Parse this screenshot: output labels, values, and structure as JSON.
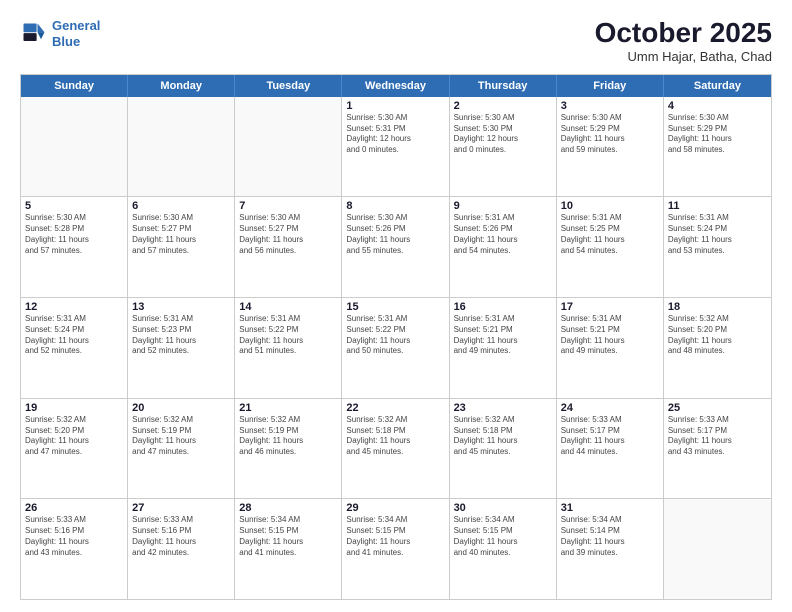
{
  "header": {
    "logo_line1": "General",
    "logo_line2": "Blue",
    "month": "October 2025",
    "location": "Umm Hajar, Batha, Chad"
  },
  "weekdays": [
    "Sunday",
    "Monday",
    "Tuesday",
    "Wednesday",
    "Thursday",
    "Friday",
    "Saturday"
  ],
  "rows": [
    [
      {
        "day": "",
        "text": "",
        "empty": true
      },
      {
        "day": "",
        "text": "",
        "empty": true
      },
      {
        "day": "",
        "text": "",
        "empty": true
      },
      {
        "day": "1",
        "text": "Sunrise: 5:30 AM\nSunset: 5:31 PM\nDaylight: 12 hours\nand 0 minutes."
      },
      {
        "day": "2",
        "text": "Sunrise: 5:30 AM\nSunset: 5:30 PM\nDaylight: 12 hours\nand 0 minutes."
      },
      {
        "day": "3",
        "text": "Sunrise: 5:30 AM\nSunset: 5:29 PM\nDaylight: 11 hours\nand 59 minutes."
      },
      {
        "day": "4",
        "text": "Sunrise: 5:30 AM\nSunset: 5:29 PM\nDaylight: 11 hours\nand 58 minutes."
      }
    ],
    [
      {
        "day": "5",
        "text": "Sunrise: 5:30 AM\nSunset: 5:28 PM\nDaylight: 11 hours\nand 57 minutes."
      },
      {
        "day": "6",
        "text": "Sunrise: 5:30 AM\nSunset: 5:27 PM\nDaylight: 11 hours\nand 57 minutes."
      },
      {
        "day": "7",
        "text": "Sunrise: 5:30 AM\nSunset: 5:27 PM\nDaylight: 11 hours\nand 56 minutes."
      },
      {
        "day": "8",
        "text": "Sunrise: 5:30 AM\nSunset: 5:26 PM\nDaylight: 11 hours\nand 55 minutes."
      },
      {
        "day": "9",
        "text": "Sunrise: 5:31 AM\nSunset: 5:26 PM\nDaylight: 11 hours\nand 54 minutes."
      },
      {
        "day": "10",
        "text": "Sunrise: 5:31 AM\nSunset: 5:25 PM\nDaylight: 11 hours\nand 54 minutes."
      },
      {
        "day": "11",
        "text": "Sunrise: 5:31 AM\nSunset: 5:24 PM\nDaylight: 11 hours\nand 53 minutes."
      }
    ],
    [
      {
        "day": "12",
        "text": "Sunrise: 5:31 AM\nSunset: 5:24 PM\nDaylight: 11 hours\nand 52 minutes."
      },
      {
        "day": "13",
        "text": "Sunrise: 5:31 AM\nSunset: 5:23 PM\nDaylight: 11 hours\nand 52 minutes."
      },
      {
        "day": "14",
        "text": "Sunrise: 5:31 AM\nSunset: 5:22 PM\nDaylight: 11 hours\nand 51 minutes."
      },
      {
        "day": "15",
        "text": "Sunrise: 5:31 AM\nSunset: 5:22 PM\nDaylight: 11 hours\nand 50 minutes."
      },
      {
        "day": "16",
        "text": "Sunrise: 5:31 AM\nSunset: 5:21 PM\nDaylight: 11 hours\nand 49 minutes."
      },
      {
        "day": "17",
        "text": "Sunrise: 5:31 AM\nSunset: 5:21 PM\nDaylight: 11 hours\nand 49 minutes."
      },
      {
        "day": "18",
        "text": "Sunrise: 5:32 AM\nSunset: 5:20 PM\nDaylight: 11 hours\nand 48 minutes."
      }
    ],
    [
      {
        "day": "19",
        "text": "Sunrise: 5:32 AM\nSunset: 5:20 PM\nDaylight: 11 hours\nand 47 minutes."
      },
      {
        "day": "20",
        "text": "Sunrise: 5:32 AM\nSunset: 5:19 PM\nDaylight: 11 hours\nand 47 minutes."
      },
      {
        "day": "21",
        "text": "Sunrise: 5:32 AM\nSunset: 5:19 PM\nDaylight: 11 hours\nand 46 minutes."
      },
      {
        "day": "22",
        "text": "Sunrise: 5:32 AM\nSunset: 5:18 PM\nDaylight: 11 hours\nand 45 minutes."
      },
      {
        "day": "23",
        "text": "Sunrise: 5:32 AM\nSunset: 5:18 PM\nDaylight: 11 hours\nand 45 minutes."
      },
      {
        "day": "24",
        "text": "Sunrise: 5:33 AM\nSunset: 5:17 PM\nDaylight: 11 hours\nand 44 minutes."
      },
      {
        "day": "25",
        "text": "Sunrise: 5:33 AM\nSunset: 5:17 PM\nDaylight: 11 hours\nand 43 minutes."
      }
    ],
    [
      {
        "day": "26",
        "text": "Sunrise: 5:33 AM\nSunset: 5:16 PM\nDaylight: 11 hours\nand 43 minutes."
      },
      {
        "day": "27",
        "text": "Sunrise: 5:33 AM\nSunset: 5:16 PM\nDaylight: 11 hours\nand 42 minutes."
      },
      {
        "day": "28",
        "text": "Sunrise: 5:34 AM\nSunset: 5:15 PM\nDaylight: 11 hours\nand 41 minutes."
      },
      {
        "day": "29",
        "text": "Sunrise: 5:34 AM\nSunset: 5:15 PM\nDaylight: 11 hours\nand 41 minutes."
      },
      {
        "day": "30",
        "text": "Sunrise: 5:34 AM\nSunset: 5:15 PM\nDaylight: 11 hours\nand 40 minutes."
      },
      {
        "day": "31",
        "text": "Sunrise: 5:34 AM\nSunset: 5:14 PM\nDaylight: 11 hours\nand 39 minutes."
      },
      {
        "day": "",
        "text": "",
        "empty": true
      }
    ]
  ]
}
